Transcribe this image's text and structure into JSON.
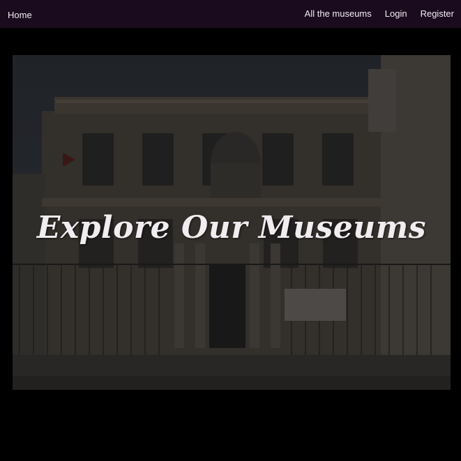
{
  "navbar": {
    "home": "Home",
    "links": [
      "All the museums",
      "Login",
      "Register"
    ]
  },
  "hero": {
    "title": "Explore Our Museums"
  },
  "colors": {
    "navbar_bg": "#1a0c1e",
    "page_bg": "#000000",
    "text": "#f2eef3"
  }
}
